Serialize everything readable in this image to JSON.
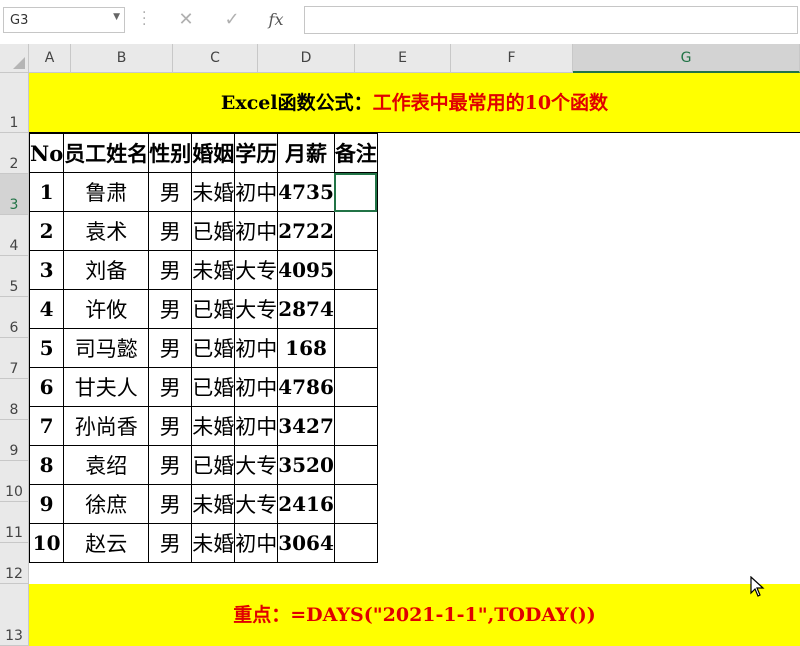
{
  "formula_bar": {
    "name_box": "G3",
    "cancel_icon": "✕",
    "enter_icon": "✓",
    "fx_label": "fx",
    "formula": ""
  },
  "columns": [
    "A",
    "B",
    "C",
    "D",
    "E",
    "F",
    "G"
  ],
  "rows": [
    "1",
    "2",
    "3",
    "4",
    "5",
    "6",
    "7",
    "8",
    "9",
    "10",
    "11",
    "12",
    "13"
  ],
  "title": {
    "part1": "Excel函数公式：",
    "part2": "工作表中最常用的10个函数",
    "part1_color": "#000000",
    "part2_color": "#e00000",
    "bg_color": "#ffff00"
  },
  "table": {
    "headers": [
      "No",
      "员工姓名",
      "性别",
      "婚姻",
      "学历",
      "月薪",
      "备注"
    ],
    "rows": [
      [
        "1",
        "鲁肃",
        "男",
        "未婚",
        "初中",
        "4735",
        ""
      ],
      [
        "2",
        "袁术",
        "男",
        "已婚",
        "初中",
        "2722",
        ""
      ],
      [
        "3",
        "刘备",
        "男",
        "未婚",
        "大专",
        "4095",
        ""
      ],
      [
        "4",
        "许攸",
        "男",
        "已婚",
        "大专",
        "2874",
        ""
      ],
      [
        "5",
        "司马懿",
        "男",
        "已婚",
        "初中",
        "168",
        ""
      ],
      [
        "6",
        "甘夫人",
        "男",
        "已婚",
        "初中",
        "4786",
        ""
      ],
      [
        "7",
        "孙尚香",
        "男",
        "未婚",
        "初中",
        "3427",
        ""
      ],
      [
        "8",
        "袁绍",
        "男",
        "已婚",
        "大专",
        "3520",
        ""
      ],
      [
        "9",
        "徐庶",
        "男",
        "未婚",
        "大专",
        "2416",
        ""
      ],
      [
        "10",
        "赵云",
        "男",
        "未婚",
        "初中",
        "3064",
        ""
      ]
    ]
  },
  "footer": {
    "text": "重点：=DAYS(\"2021-1-1\",TODAY())",
    "color": "#e00000"
  },
  "selection": {
    "active_cell": "G3",
    "accent": "#217346"
  }
}
